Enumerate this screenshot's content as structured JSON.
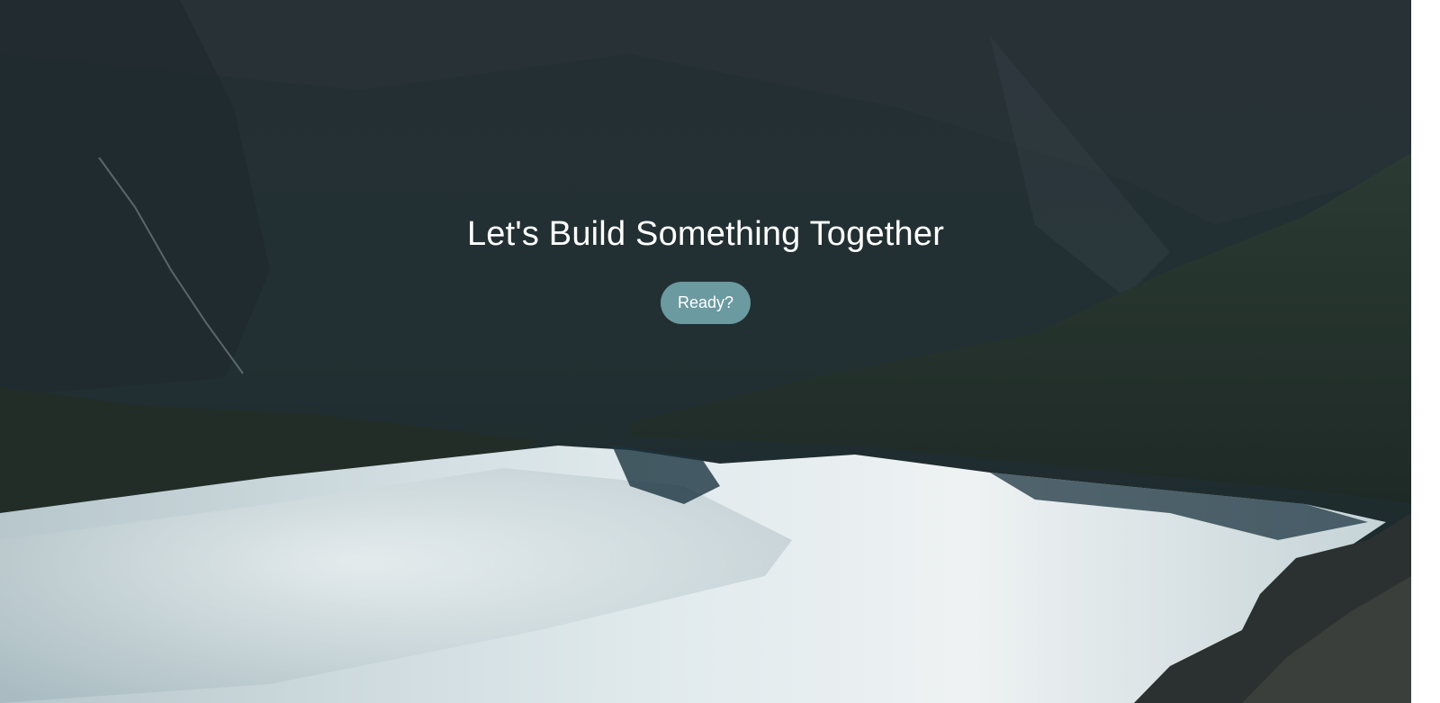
{
  "hero": {
    "headline": "Let's Build Something Together",
    "cta_label": "Ready?"
  },
  "colors": {
    "cta_background": "#6b9aa0",
    "text": "#ffffff",
    "mountain_dark": "#1f2a2c",
    "lake_light": "#dfe8ea"
  }
}
